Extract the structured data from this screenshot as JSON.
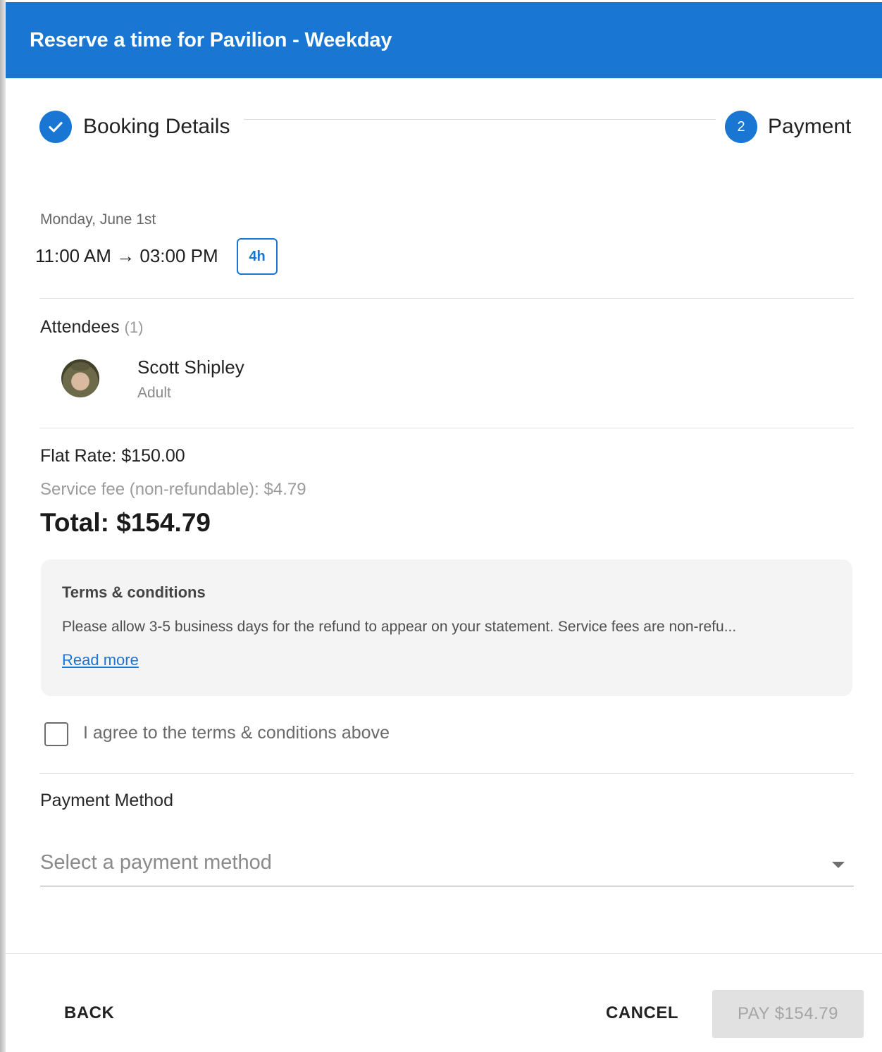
{
  "header": {
    "title": "Reserve a time for Pavilion - Weekday"
  },
  "stepper": {
    "steps": [
      {
        "label": "Booking Details",
        "state": "completed"
      },
      {
        "label": "Payment",
        "number": "2",
        "state": "active"
      }
    ]
  },
  "booking": {
    "date": "Monday, June 1st",
    "time_range": "11:00 AM → 03:00 PM",
    "duration": "4h"
  },
  "attendees": {
    "title": "Attendees",
    "count": "(1)",
    "list": [
      {
        "name": "Scott Shipley",
        "type": "Adult"
      }
    ]
  },
  "pricing": {
    "flat_rate": "Flat Rate: $150.00",
    "service_fee": "Service fee (non-refundable): $4.79",
    "total": "Total: $154.79"
  },
  "terms": {
    "title": "Terms & conditions",
    "text": "Please allow 3-5 business days for the refund to appear on your statement. Service fees are non-refu...",
    "read_more": "Read more",
    "agree_label": "I agree to the terms & conditions above",
    "agreed": false
  },
  "payment_method": {
    "title": "Payment Method",
    "placeholder": "Select a payment method"
  },
  "footer": {
    "back": "BACK",
    "cancel": "CANCEL",
    "pay": "PAY $154.79"
  },
  "colors": {
    "primary": "#1976d2",
    "header_text": "#ffffff",
    "disabled_bg": "#e1e1e1",
    "disabled_text": "#a5a5a5"
  }
}
